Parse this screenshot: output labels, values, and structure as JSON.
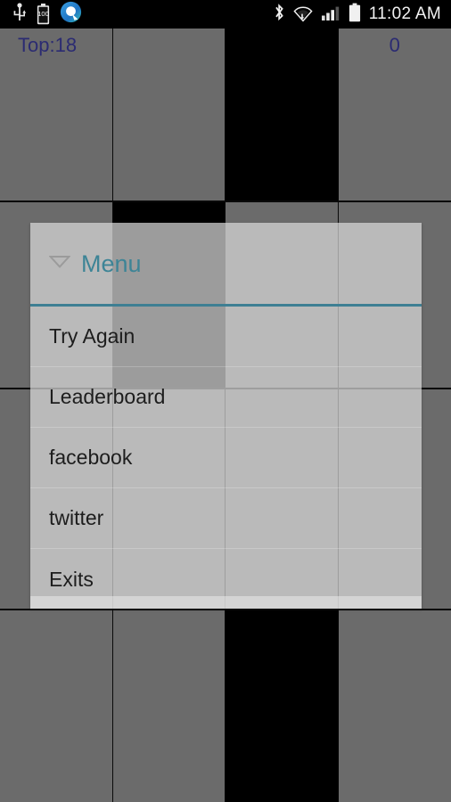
{
  "statusbar": {
    "time": "11:02 AM",
    "battery_level": "100",
    "left_icons": [
      "usb-icon",
      "battery-percent-icon",
      "qihoo-app-icon"
    ],
    "right_icons": [
      "bluetooth-icon",
      "wifi-icon",
      "cellular-signal-icon",
      "battery-icon"
    ]
  },
  "game": {
    "top_score_label": "Top:18",
    "current_score": "0",
    "accent_tile_color": "#000000",
    "background_color": "#6b6b6b",
    "score_text_color": "#2b2b72",
    "rows": [
      {
        "cells": [
          "gray",
          "gray",
          "black",
          "gray"
        ]
      },
      {
        "cells": [
          "gray",
          "black",
          "gray",
          "gray"
        ]
      },
      {
        "cells": [
          "gray",
          "gray",
          "gray",
          "gray"
        ]
      },
      {
        "cells": [
          "gray",
          "gray",
          "black",
          "gray"
        ]
      }
    ]
  },
  "dialog": {
    "title": "Menu",
    "title_color": "#3d8496",
    "divider_color": "#3e7f93",
    "caret_icon": "chevron-down-icon",
    "items": [
      {
        "label": "Try Again"
      },
      {
        "label": "Leaderboard"
      },
      {
        "label": "facebook"
      },
      {
        "label": "twitter"
      },
      {
        "label": "Exits"
      }
    ]
  }
}
